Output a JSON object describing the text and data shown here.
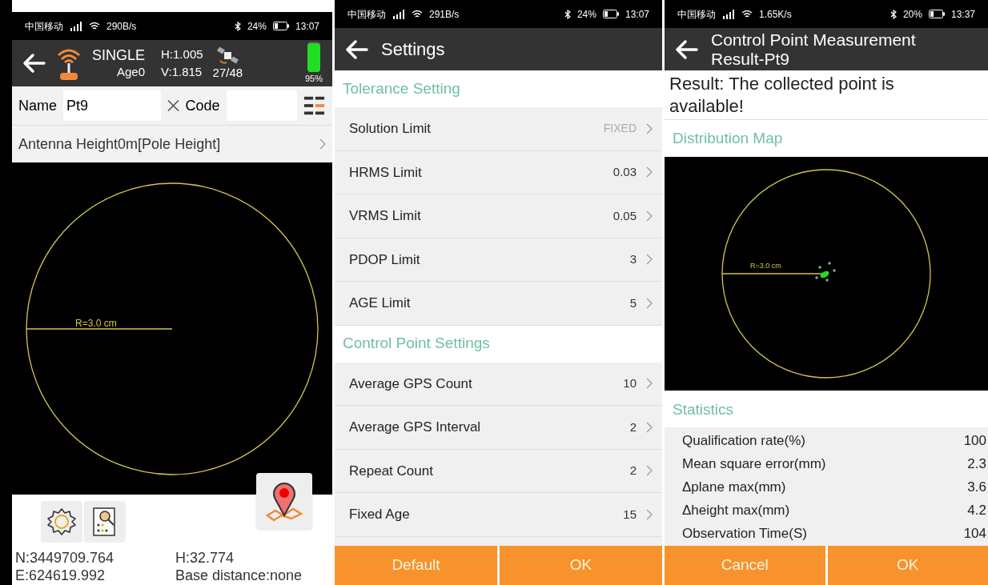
{
  "panels": [
    {
      "kind": "survey",
      "status_bar": {
        "carrier": "中国移动",
        "speed": "290B/s",
        "battery": "24%",
        "time": "13:07"
      },
      "header": {
        "solution": "SINGLE",
        "age": "Age0",
        "h": "H:1.005",
        "v": "V:1.815",
        "satellites": "27/48",
        "battery": "95%",
        "level": 0.95
      },
      "name_label": "Name",
      "name_value": "Pt9",
      "code_label": "Code",
      "antenna": "Antenna Height0m[Pole Height]",
      "map": {
        "radius_label": "R=3.0 cm"
      },
      "coords": {
        "n": "N:3449709.764",
        "h": "H:32.774",
        "e": "E:624619.992",
        "base": "Base distance:none"
      }
    },
    {
      "kind": "settings",
      "status_bar": {
        "carrier": "中国移动",
        "speed": "291B/s",
        "battery": "24%",
        "time": "13:07"
      },
      "title": "Settings",
      "sections": [
        {
          "title": "Tolerance Setting",
          "rows": [
            {
              "label": "Solution Limit",
              "value": "FIXED",
              "muted": true
            },
            {
              "label": "HRMS Limit",
              "value": "0.03",
              "muted": false
            },
            {
              "label": "VRMS Limit",
              "value": "0.05",
              "muted": false
            },
            {
              "label": "PDOP Limit",
              "value": "3",
              "muted": false
            },
            {
              "label": "AGE Limit",
              "value": "5",
              "muted": false
            }
          ]
        },
        {
          "title": "Control Point Settings",
          "rows": [
            {
              "label": "Average GPS Count",
              "value": "10",
              "muted": false
            },
            {
              "label": "Average GPS Interval",
              "value": "2",
              "muted": false
            },
            {
              "label": "Repeat Count",
              "value": "2",
              "muted": false
            },
            {
              "label": "Fixed Age",
              "value": "15",
              "muted": false
            }
          ]
        }
      ],
      "buttons": [
        "Default",
        "OK"
      ]
    },
    {
      "kind": "result",
      "status_bar": {
        "carrier": "中国移动",
        "speed": "1.65K/s",
        "battery": "20%",
        "time": "13:37"
      },
      "title": "Control Point Measurement Result-Pt9",
      "result": "Result: The collected point is available!",
      "map_title": "Distribution Map",
      "map": {
        "radius_label": "R=3.0 cm"
      },
      "stats_title": "Statistics",
      "stats": [
        {
          "label": "Qualification rate(%)",
          "value": "100"
        },
        {
          "label": "Mean square error(mm)",
          "value": "2.3"
        },
        {
          "label": "Δplane max(mm)",
          "value": "3.6"
        },
        {
          "label": "Δheight max(mm)",
          "value": "4.2"
        },
        {
          "label": "Observation Time(S)",
          "value": "104"
        }
      ],
      "buttons": [
        "Cancel",
        "OK"
      ]
    }
  ]
}
